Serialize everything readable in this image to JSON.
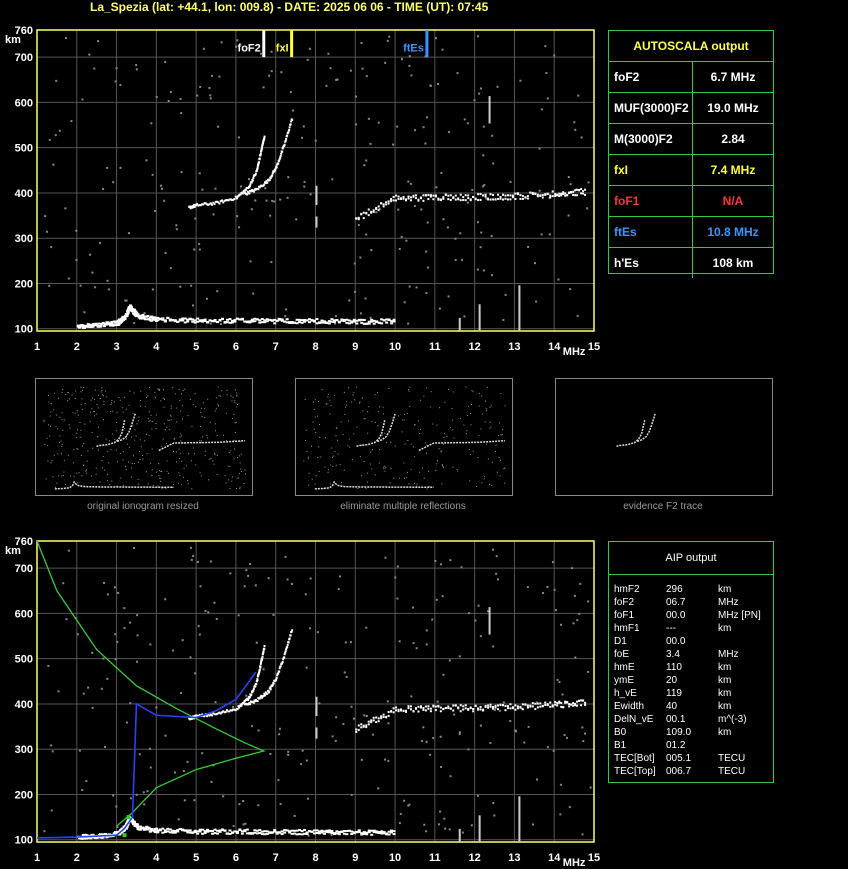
{
  "header": {
    "title": "La_Spezia (lat: +44.1, lon: 009.8) - DATE: 2025 06 06 - TIME (UT): 07:45"
  },
  "colors": {
    "axis": "#ffff66",
    "grid": "#555555",
    "border": "#2ecc40",
    "foF2": "#ffffff",
    "fxI": "#ffff33",
    "ftEs": "#3399ff",
    "foF1": "#ff3333",
    "profile": "#33cc33",
    "aip_trace": "#2244ff"
  },
  "ionogram_top": {
    "y_unit": "km",
    "x_unit": "MHz",
    "y_ticks": [
      "100",
      "200",
      "300",
      "400",
      "500",
      "600",
      "700",
      "760"
    ],
    "x_ticks": [
      "1",
      "2",
      "3",
      "4",
      "5",
      "6",
      "7",
      "8",
      "9",
      "10",
      "11",
      "12",
      "13",
      "14",
      "15"
    ],
    "markers": [
      {
        "label": "foF2",
        "freq": 6.7,
        "color": "#ffffff"
      },
      {
        "label": "fxI",
        "freq": 7.4,
        "color": "#ffff33"
      },
      {
        "label": "ftEs",
        "freq": 10.8,
        "color": "#3399ff"
      }
    ]
  },
  "autoscala": {
    "title": "AUTOSCALA output",
    "rows": [
      {
        "key": "foF2",
        "value": "6.7 MHz",
        "color": "#ffffff"
      },
      {
        "key": "MUF(3000)F2",
        "value": "19.0 MHz",
        "color": "#ffffff"
      },
      {
        "key": "M(3000)F2",
        "value": "2.84",
        "color": "#ffffff"
      },
      {
        "key": "fxI",
        "value": "7.4 MHz",
        "color": "#ffff33"
      },
      {
        "key": "foF1",
        "value": "N/A",
        "color": "#ff3333"
      },
      {
        "key": "ftEs",
        "value": "10.8 MHz",
        "color": "#3399ff"
      },
      {
        "key": "h'Es",
        "value": "108     km",
        "color": "#ffffff"
      }
    ]
  },
  "thumbnails": [
    {
      "caption": "original ionogram resized"
    },
    {
      "caption": "eliminate multiple reflections"
    },
    {
      "caption": "evidence F2 trace"
    }
  ],
  "aip": {
    "title": "AIP output",
    "rows": [
      {
        "k": "hmF2",
        "v": "296",
        "u": "km"
      },
      {
        "k": "foF2",
        "v": "06.7",
        "u": "MHz"
      },
      {
        "k": "foF1",
        "v": "00.0",
        "u": "MHz   [PN]"
      },
      {
        "k": "hmF1",
        "v": "---",
        "u": "km"
      },
      {
        "k": "D1",
        "v": "00.0",
        "u": ""
      },
      {
        "k": "foE",
        "v": "3.4",
        "u": "MHz"
      },
      {
        "k": "hmE",
        "v": "110",
        "u": "km"
      },
      {
        "k": "ymE",
        "v": "20",
        "u": "km"
      },
      {
        "k": "h_vE",
        "v": "119",
        "u": "km"
      },
      {
        "k": "Ewidth",
        "v": "40",
        "u": "km"
      },
      {
        "k": "DelN_vE",
        "v": "00.1",
        "u": "m^(-3)"
      },
      {
        "k": "B0",
        "v": "109.0",
        "u": "km"
      },
      {
        "k": "B1",
        "v": "01.2",
        "u": ""
      },
      {
        "k": "TEC[Bot]",
        "v": "005.1",
        "u": "TECU"
      },
      {
        "k": "TEC[Top]",
        "v": "006.7",
        "u": "TECU"
      }
    ]
  },
  "chart_data": [
    {
      "type": "scatter",
      "title": "",
      "xlabel": "MHz",
      "ylabel": "km",
      "xlim": [
        1,
        15
      ],
      "ylim": [
        95,
        760
      ],
      "series": [
        {
          "name": "foF2",
          "x": [
            6.7
          ],
          "y": [
            700
          ]
        },
        {
          "name": "fxI",
          "x": [
            7.4
          ],
          "y": [
            700
          ]
        },
        {
          "name": "ftEs",
          "x": [
            10.8
          ],
          "y": [
            700
          ]
        }
      ],
      "traces": {
        "E_layer": {
          "x": [
            2.0,
            2.5,
            3.0,
            3.2,
            3.3,
            3.5,
            4.0,
            5.0,
            6.0,
            7.0,
            8.0,
            9.0,
            10.0
          ],
          "y": [
            108,
            110,
            115,
            130,
            150,
            130,
            122,
            120,
            120,
            119,
            119,
            118,
            118
          ]
        },
        "F2_ordinary": {
          "x": [
            4.8,
            5.0,
            5.5,
            6.0,
            6.3,
            6.5,
            6.6,
            6.7
          ],
          "y": [
            370,
            375,
            380,
            392,
            415,
            450,
            490,
            530
          ]
        },
        "F2_extraordinary": {
          "x": [
            6.2,
            6.5,
            6.8,
            7.0,
            7.2,
            7.4
          ],
          "y": [
            400,
            410,
            430,
            460,
            510,
            570
          ]
        },
        "Es_blanket": {
          "x": [
            9.0,
            10.0,
            11.0,
            12.0,
            13.0,
            14.0,
            14.8
          ],
          "y": [
            345,
            390,
            392,
            393,
            395,
            400,
            405
          ]
        }
      }
    },
    {
      "type": "line",
      "title": "",
      "xlabel": "MHz",
      "ylabel": "km",
      "xlim": [
        1,
        15
      ],
      "ylim": [
        95,
        760
      ],
      "series": [
        {
          "name": "electron_density_profile",
          "x": [
            1.0,
            1.5,
            2.5,
            3.5,
            4.5,
            5.5,
            6.2,
            6.7,
            6.0,
            5.0,
            4.0,
            3.4,
            3.0
          ],
          "y": [
            760,
            650,
            520,
            440,
            390,
            345,
            315,
            296,
            280,
            255,
            215,
            160,
            130
          ]
        },
        {
          "name": "AIP_fit",
          "x": [
            1.0,
            2.0,
            3.0,
            3.2,
            3.4,
            3.5,
            4.0,
            5.0,
            5.5,
            6.0,
            6.5
          ],
          "y": [
            104,
            106,
            110,
            125,
            150,
            400,
            375,
            370,
            385,
            410,
            470
          ]
        }
      ]
    }
  ]
}
